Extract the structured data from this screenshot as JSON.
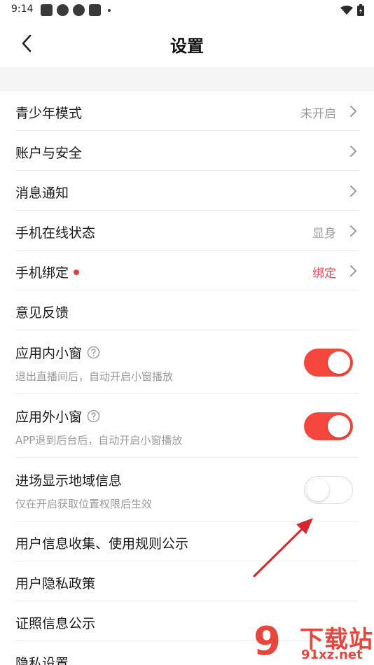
{
  "status_bar": {
    "time": "9:14"
  },
  "header": {
    "title": "设置"
  },
  "settings": [
    {
      "title": "青少年模式",
      "value": "未开启",
      "chevron": true
    },
    {
      "title": "账户与安全",
      "chevron": true
    },
    {
      "title": "消息通知",
      "chevron": true
    },
    {
      "title": "手机在线状态",
      "value": "显身",
      "chevron": true
    },
    {
      "title": "手机绑定",
      "value": "绑定",
      "value_color": "#f0485a",
      "red_dot": true,
      "chevron": true
    },
    {
      "title": "意见反馈"
    },
    {
      "title": "应用内小窗",
      "subtitle": "退出直播间后，自动开启小窗播放",
      "help": true,
      "toggle": true
    },
    {
      "title": "应用外小窗",
      "subtitle": "APP退到后台后，自动开启小窗播放",
      "help": true,
      "toggle": true
    },
    {
      "title": "进场显示地域信息",
      "subtitle": "仅在开启获取位置权限后生效",
      "toggle": false
    },
    {
      "title": "用户信息收集、使用规则公示"
    },
    {
      "title": "用户隐私政策"
    },
    {
      "title": "证照信息公示"
    },
    {
      "title": "隐私设置"
    }
  ],
  "watermark": {
    "logo": "9",
    "title": "下载站",
    "url": "91xz.net"
  },
  "colors": {
    "accent": "#f5473d",
    "toggle_off_border": "#dcdcdc",
    "annotation_arrow": "#d9262c"
  }
}
